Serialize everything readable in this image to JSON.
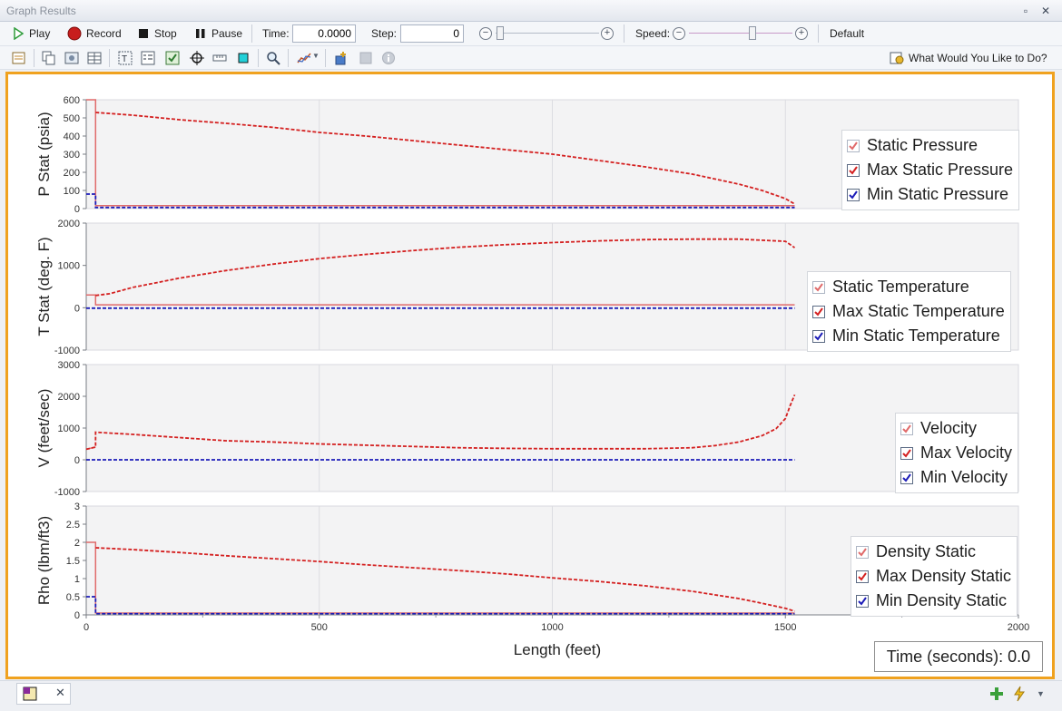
{
  "window": {
    "title": "Graph Results"
  },
  "toolbar": {
    "play_label": "Play",
    "record_label": "Record",
    "stop_label": "Stop",
    "pause_label": "Pause",
    "time_label": "Time:",
    "time_value": "0.0000",
    "step_label": "Step:",
    "step_value": "0",
    "speed_label": "Speed:",
    "default_label": "Default",
    "help_label": "What Would You Like to Do?"
  },
  "colors": {
    "max_series": "#d42020",
    "min_series": "#1c1cb8",
    "static_series": "#e06a6a",
    "frame_accent": "#f0a21f"
  },
  "chart_data": [
    {
      "type": "line",
      "ylabel": "P Stat (psia)",
      "ylim": [
        0,
        600
      ],
      "yticks": [
        0,
        100,
        200,
        300,
        400,
        500,
        600
      ],
      "xlim": [
        0,
        2000
      ],
      "grid": true,
      "legend_position": "right",
      "legend": [
        "Static Pressure",
        "Max Static Pressure",
        "Min Static Pressure"
      ],
      "series": [
        {
          "name": "Static Pressure",
          "style": "solid",
          "x": [
            0,
            20,
            20,
            1520
          ],
          "y": [
            600,
            600,
            16,
            16
          ]
        },
        {
          "name": "Max Static Pressure",
          "style": "dashed",
          "x": [
            20,
            100,
            200,
            300,
            400,
            500,
            600,
            700,
            800,
            900,
            1000,
            1100,
            1200,
            1300,
            1400,
            1450,
            1500,
            1520
          ],
          "y": [
            530,
            515,
            490,
            470,
            448,
            420,
            400,
            375,
            350,
            325,
            300,
            265,
            230,
            190,
            135,
            100,
            55,
            25
          ]
        },
        {
          "name": "Min Static Pressure",
          "style": "dashed",
          "x": [
            0,
            20,
            20,
            1520
          ],
          "y": [
            80,
            80,
            6,
            6
          ]
        }
      ]
    },
    {
      "type": "line",
      "ylabel": "T Stat (deg. F)",
      "ylim": [
        -1000,
        2000
      ],
      "yticks": [
        -1000,
        0,
        1000,
        2000
      ],
      "xlim": [
        0,
        2000
      ],
      "grid": true,
      "legend_position": "right",
      "legend": [
        "Static Temperature",
        "Max Static Temperature",
        "Min Static Temperature"
      ],
      "series": [
        {
          "name": "Static Temperature",
          "style": "solid",
          "x": [
            0,
            20,
            20,
            1520
          ],
          "y": [
            300,
            300,
            70,
            70
          ]
        },
        {
          "name": "Max Static Temperature",
          "style": "dashed",
          "x": [
            20,
            50,
            100,
            200,
            300,
            400,
            500,
            600,
            700,
            800,
            900,
            1000,
            1100,
            1200,
            1300,
            1400,
            1500,
            1520
          ],
          "y": [
            290,
            330,
            480,
            700,
            880,
            1030,
            1160,
            1260,
            1350,
            1430,
            1490,
            1540,
            1580,
            1610,
            1620,
            1620,
            1570,
            1420
          ]
        },
        {
          "name": "Min Static Temperature",
          "style": "dashed",
          "x": [
            0,
            1520
          ],
          "y": [
            -10,
            -10
          ]
        }
      ]
    },
    {
      "type": "line",
      "ylabel": "V (feet/sec)",
      "ylim": [
        -1000,
        3000
      ],
      "yticks": [
        -1000,
        0,
        1000,
        2000,
        3000
      ],
      "xlim": [
        0,
        2000
      ],
      "grid": true,
      "legend_position": "right",
      "legend": [
        "Velocity",
        "Max Velocity",
        "Min Velocity"
      ],
      "series": [
        {
          "name": "Velocity",
          "style": "solid",
          "x": [
            0,
            20
          ],
          "y": [
            330,
            400
          ]
        },
        {
          "name": "Max Velocity",
          "style": "dashed",
          "x": [
            0,
            20,
            20,
            100,
            200,
            300,
            400,
            500,
            600,
            700,
            800,
            900,
            1000,
            1100,
            1200,
            1300,
            1350,
            1400,
            1450,
            1480,
            1500,
            1510,
            1520
          ],
          "y": [
            330,
            400,
            870,
            800,
            700,
            600,
            560,
            500,
            460,
            420,
            380,
            360,
            350,
            350,
            350,
            380,
            450,
            560,
            760,
            980,
            1300,
            1700,
            2050
          ]
        },
        {
          "name": "Min Velocity",
          "style": "dashed",
          "x": [
            0,
            1520
          ],
          "y": [
            0,
            0
          ]
        }
      ]
    },
    {
      "type": "line",
      "ylabel": "Rho (lbm/ft3)",
      "xlabel": "Length (feet)",
      "ylim": [
        0,
        3
      ],
      "yticks": [
        0,
        0.5,
        1,
        1.5,
        2,
        2.5,
        3
      ],
      "xlim": [
        0,
        2000
      ],
      "xticks": [
        0,
        500,
        1000,
        1500,
        2000
      ],
      "grid": true,
      "legend_position": "right",
      "legend": [
        "Density Static",
        "Max Density Static",
        "Min Density Static"
      ],
      "series": [
        {
          "name": "Density Static",
          "style": "solid",
          "x": [
            0,
            20,
            20,
            1520
          ],
          "y": [
            2.0,
            2.0,
            0.05,
            0.05
          ]
        },
        {
          "name": "Max Density Static",
          "style": "dashed",
          "x": [
            20,
            100,
            200,
            300,
            400,
            500,
            600,
            700,
            800,
            900,
            1000,
            1100,
            1200,
            1300,
            1400,
            1450,
            1500,
            1520
          ],
          "y": [
            1.85,
            1.8,
            1.72,
            1.63,
            1.55,
            1.47,
            1.38,
            1.3,
            1.22,
            1.13,
            1.02,
            0.92,
            0.8,
            0.65,
            0.45,
            0.32,
            0.18,
            0.1
          ]
        },
        {
          "name": "Min Density Static",
          "style": "dashed",
          "x": [
            0,
            20,
            20,
            1520
          ],
          "y": [
            0.5,
            0.5,
            0.03,
            0.03
          ]
        }
      ]
    }
  ],
  "time_readout": "Time (seconds): 0.0"
}
